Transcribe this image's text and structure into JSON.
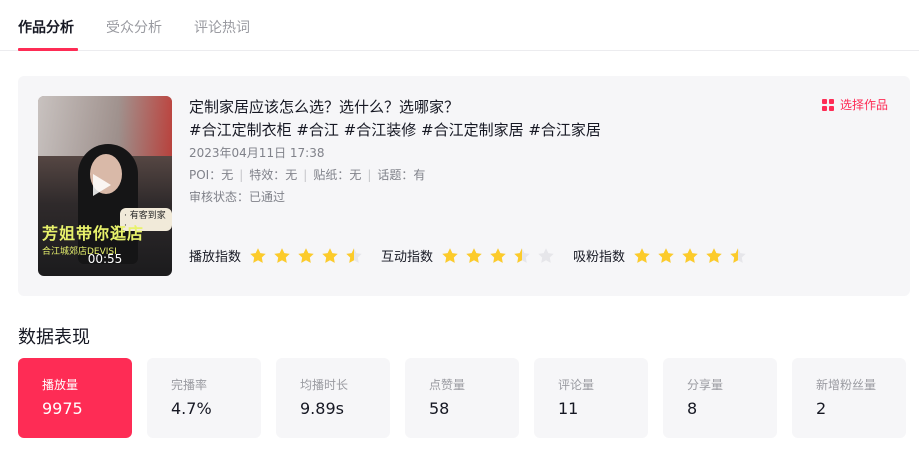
{
  "tabs": [
    {
      "label": "作品分析",
      "active": true
    },
    {
      "label": "受众分析",
      "active": false
    },
    {
      "label": "评论热词",
      "active": false
    }
  ],
  "video": {
    "title_line1": "定制家居应该怎么选？选什么？选哪家？",
    "title_line2": "#合江定制衣柜 #合江 #合江装修 #合江定制家居 #合江家居",
    "date": "2023年04月11日 17:38",
    "poi": "POI：无",
    "effect": "特效：无",
    "sticker": "贴纸：无",
    "topic": "话题：有",
    "review_status": "审核状态：已通过",
    "duration": "00:55",
    "cover_text": {
      "badge": "· 有客到家 ·",
      "headline": "芳姐带你逛店",
      "subline": "合江城郊店DEVISI"
    },
    "select_label": "选择作品"
  },
  "ratings": [
    {
      "label": "播放指数",
      "stars": 4.5
    },
    {
      "label": "互动指数",
      "stars": 3.5
    },
    {
      "label": "吸粉指数",
      "stars": 4.5
    }
  ],
  "section_title": "数据表现",
  "metrics": [
    {
      "label": "播放量",
      "value": "9975",
      "active": true
    },
    {
      "label": "完播率",
      "value": "4.7%",
      "active": false
    },
    {
      "label": "均播时长",
      "value": "9.89s",
      "active": false
    },
    {
      "label": "点赞量",
      "value": "58",
      "active": false
    },
    {
      "label": "评论量",
      "value": "11",
      "active": false
    },
    {
      "label": "分享量",
      "value": "8",
      "active": false
    },
    {
      "label": "新增粉丝量",
      "value": "2",
      "active": false
    }
  ],
  "colors": {
    "accent": "#fe2c55",
    "star": "#fccb2b",
    "star_empty": "#e6e6ea",
    "card_bg": "#f6f6f8"
  }
}
